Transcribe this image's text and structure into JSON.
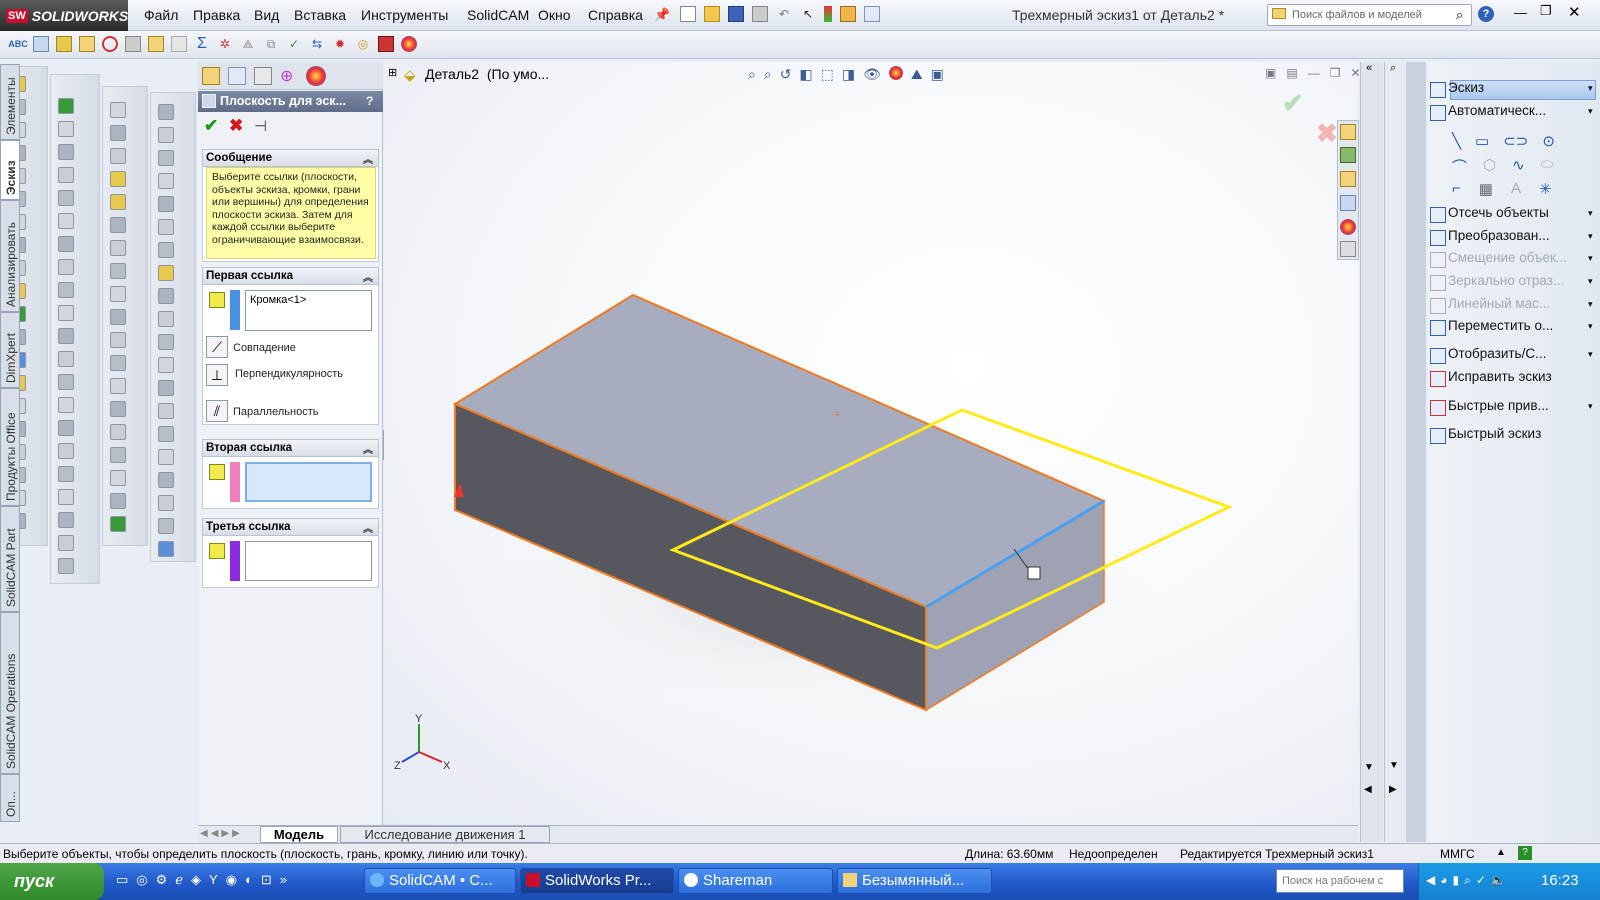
{
  "app": {
    "logo_text": "SOLIDWORKS",
    "logo_badge": "SW"
  },
  "menu": [
    "Файл",
    "Правка",
    "Вид",
    "Вставка",
    "Инструменты",
    "SolidCAM",
    "Окно",
    "Справка"
  ],
  "document_title": "Трехмерный эскиз1 от Деталь2 *",
  "search": {
    "placeholder": "Поиск файлов и моделей"
  },
  "property_manager": {
    "title": "Плоскость для эск...",
    "help": "?",
    "message": {
      "header": "Сообщение",
      "text": "Выберите ссылки (плоскости, объекты эскиза, кромки, грани или вершины) для определения плоскости эскиза. Затем для каждой ссылки выберите ограничивающие взаимосвязи."
    },
    "first_ref": {
      "header": "Первая ссылка",
      "value": "Кромка<1>",
      "color": "#4a90e2"
    },
    "relations": [
      "Совпадение",
      "Перпендикулярность",
      "Параллельность"
    ],
    "second_ref": {
      "header": "Вторая ссылка",
      "value": "",
      "color": "#f07fc0"
    },
    "third_ref": {
      "header": "Третья ссылка",
      "value": "",
      "color": "#8a2be2"
    }
  },
  "feature_tree": {
    "node": "Деталь2",
    "config": "(По умо..."
  },
  "bottom_tabs": [
    "Модель",
    "Исследование движения 1"
  ],
  "vertical_tabs": [
    "Элементы",
    "Эскиз",
    "Анализировать",
    "DimXpert",
    "Продукты Office",
    "SolidCAM Part",
    "SolidCAM Operations",
    "Оп..."
  ],
  "command_panel": [
    {
      "label": "Эскиз",
      "enabled": true,
      "active": true,
      "icon": "sketch-icon"
    },
    {
      "label": "Автоматическ...",
      "enabled": true,
      "icon": "smart-dimension-icon"
    },
    {
      "label": "Отсечь объекты",
      "enabled": true,
      "icon": "trim-icon"
    },
    {
      "label": "Преобразован...",
      "enabled": true,
      "icon": "convert-icon"
    },
    {
      "label": "Смещение объек...",
      "enabled": false,
      "icon": "offset-icon"
    },
    {
      "label": "Зеркально отраз...",
      "enabled": false,
      "icon": "mirror-icon"
    },
    {
      "label": "Линейный мас...",
      "enabled": false,
      "icon": "pattern-icon"
    },
    {
      "label": "Переместить о...",
      "enabled": true,
      "icon": "move-icon"
    },
    {
      "label": "Отобразить/С...",
      "enabled": true,
      "icon": "display-icon"
    },
    {
      "label": "Исправить эскиз",
      "enabled": true,
      "icon": "repair-icon"
    },
    {
      "label": "Быстрые прив...",
      "enabled": true,
      "icon": "snap-icon"
    },
    {
      "label": "Быстрый эскиз",
      "enabled": true,
      "icon": "quick-sketch-icon"
    }
  ],
  "statusbar": {
    "hint": "Выберите объекты, чтобы определить плоскость (плоскость, грань, кромку, линию или точку).",
    "length": "Длина: 63.60мм",
    "state": "Недоопределен",
    "editing": "Редактируется Трехмерный эскиз1",
    "units": "ММГС"
  },
  "triad": {
    "x": "X",
    "y": "Y",
    "z": "Z"
  },
  "taskbar": {
    "start": "пуск",
    "tasks": [
      "SolidCAM • С...",
      "SolidWorks Pr...",
      "Shareman",
      "Безымянный..."
    ],
    "search_placeholder": "Поиск на рабочем с",
    "clock": "16:23"
  }
}
